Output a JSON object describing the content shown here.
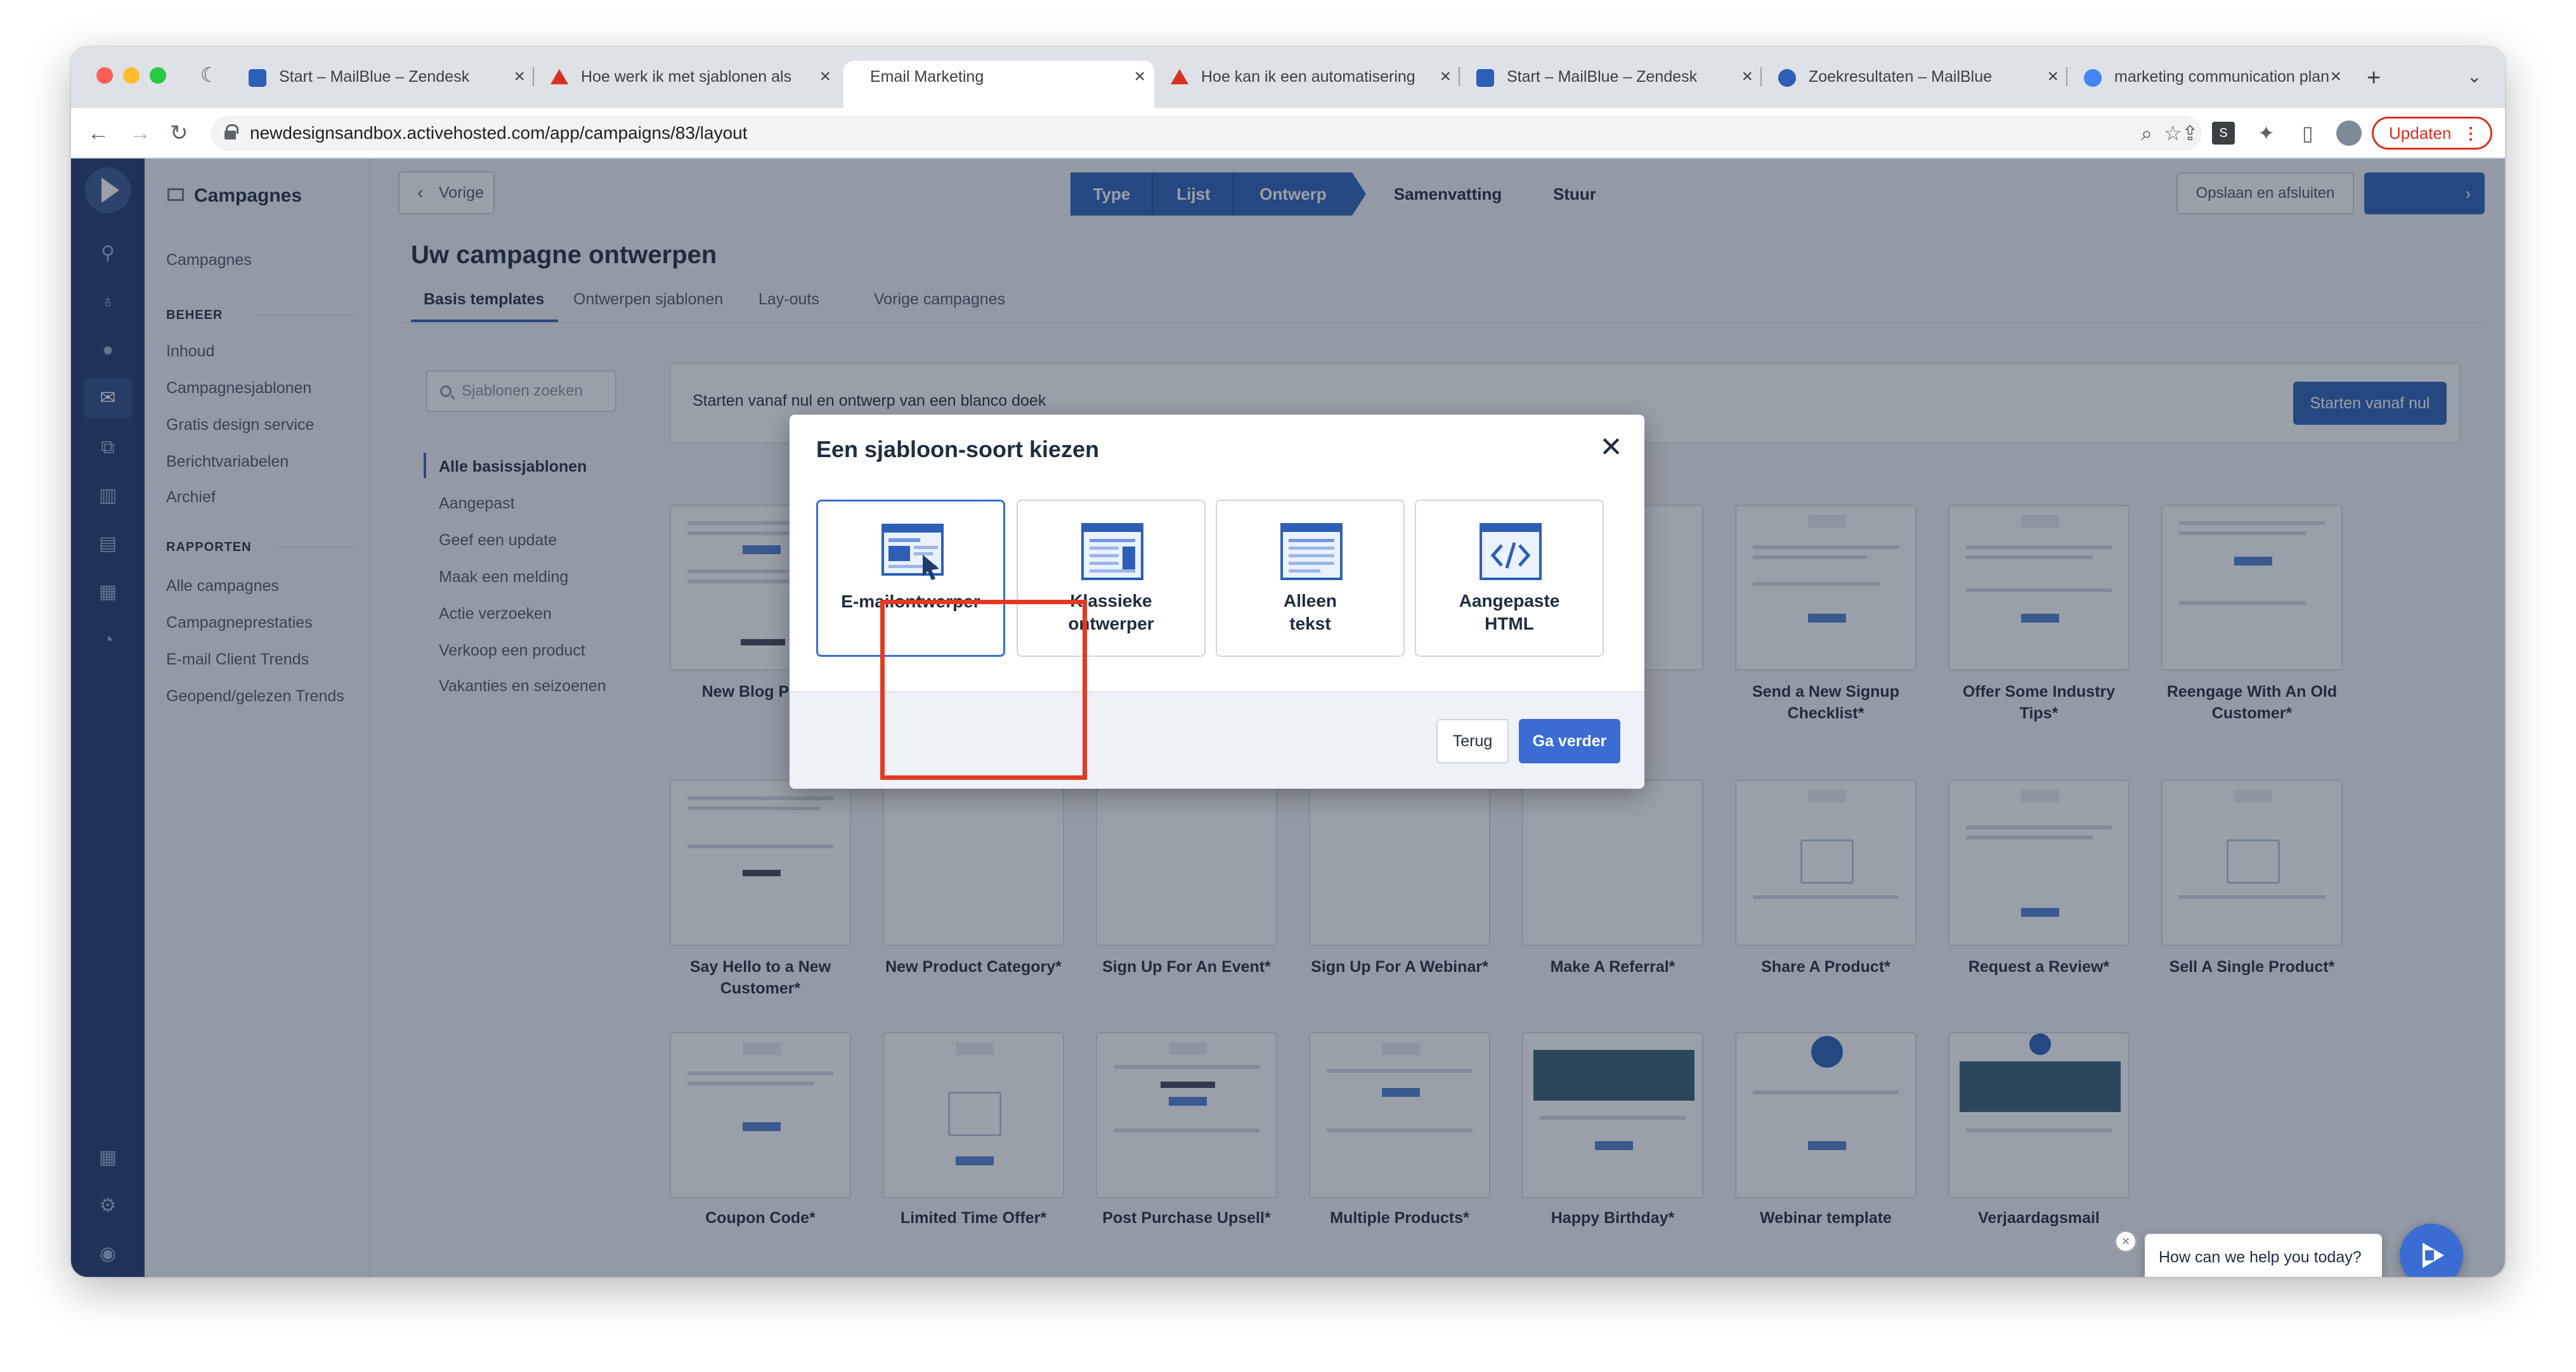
{
  "browser": {
    "tabs": [
      {
        "title": "Start – MailBlue – Zendesk",
        "favicon_color": "#2c5fb5"
      },
      {
        "title": "Hoe werk ik met sjablonen als",
        "favicon_color": "#d93025"
      },
      {
        "title": "Email Marketing",
        "favicon_color": "#ffffff"
      },
      {
        "title": "Hoe kan ik een automatisering",
        "favicon_color": "#d93025"
      },
      {
        "title": "Start – MailBlue – Zendesk",
        "favicon_color": "#2c5fb5"
      },
      {
        "title": "Zoekresultaten – MailBlue",
        "favicon_color": "#2c5fb5"
      },
      {
        "title": "marketing communication plan",
        "favicon_color": "#4285f4"
      }
    ],
    "url": "newdesignsandbox.activehosted.com/app/campaigns/83/layout",
    "update_label": "Updaten"
  },
  "sidebar": {
    "title": "Campagnes",
    "top_item": "Campagnes",
    "manage_header": "BEHEER",
    "manage_items": [
      "Inhoud",
      "Campagnesjablonen",
      "Gratis design service",
      "Berichtvariabelen",
      "Archief"
    ],
    "reports_header": "RAPPORTEN",
    "reports_items": [
      "Alle campagnes",
      "Campagneprestaties",
      "E-mail Client Trends",
      "Geopend/gelezen Trends"
    ]
  },
  "header": {
    "back_label": "Vorige",
    "steps": [
      "Type",
      "Lijst",
      "Ontwerp",
      "Samenvatting",
      "Stuur"
    ],
    "save_close_label": "Opslaan en afsluiten"
  },
  "page": {
    "title": "Uw campagne ontwerpen",
    "tabs": [
      "Basis templates",
      "Ontwerpen sjablonen",
      "Lay-outs",
      "Vorige campagnes"
    ],
    "search_placeholder": "Sjablonen zoeken",
    "categories": [
      "Alle basissjablonen",
      "Aangepast",
      "Geef een update",
      "Maak een melding",
      "Actie verzoeken",
      "Verkoop een product",
      "Vakanties en seizoenen"
    ],
    "start_text": "Starten vanaf nul en ontwerp van een blanco doek",
    "start_button": "Starten vanaf nul"
  },
  "templates": [
    "New Blog Post*",
    "Send a New Signup Checklist*",
    "Offer Some Industry Tips*",
    "Reengage With An Old Customer*",
    "Say Hello to a New Customer*",
    "New Product Category*",
    "Sign Up For An Event*",
    "Sign Up For A Webinar*",
    "Make A Referral*",
    "Share A Product*",
    "Request a Review*",
    "Sell A Single Product*",
    "Coupon Code*",
    "Limited Time Offer*",
    "Post Purchase Upsell*",
    "Multiple Products*",
    "Happy Birthday*",
    "Webinar template",
    "Verjaardagsmail"
  ],
  "modal": {
    "title": "Een sjabloon-soort kiezen",
    "options": [
      {
        "label": "E-mailontwerper"
      },
      {
        "label": "Klassieke ontwerper"
      },
      {
        "label": "Alleen tekst"
      },
      {
        "label": "Aangepaste HTML"
      }
    ],
    "back_label": "Terug",
    "continue_label": "Ga verder"
  },
  "chat": {
    "prompt": "How can we help you today?"
  },
  "colors": {
    "brand_blue": "#2c5fb5",
    "rail": "#1f3a6d",
    "highlight_red": "#e53922"
  }
}
